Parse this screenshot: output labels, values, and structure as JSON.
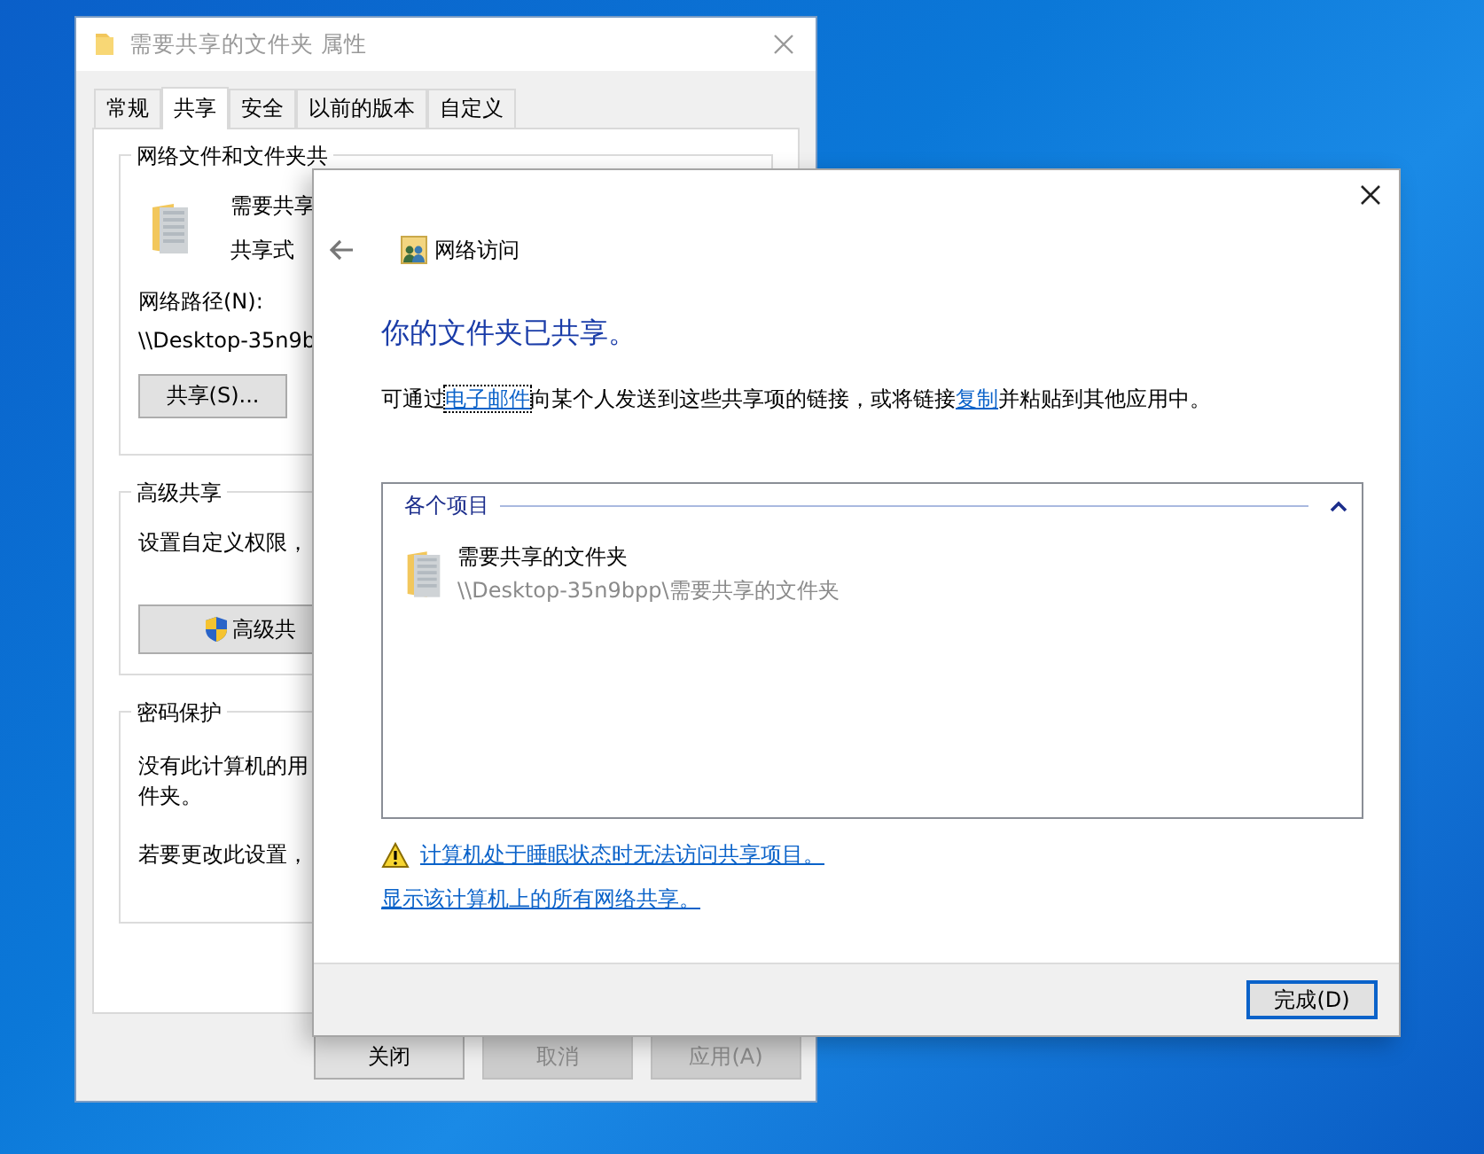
{
  "properties_window": {
    "title": "需要共享的文件夹 属性",
    "tabs": [
      {
        "label": "常规",
        "selected": false
      },
      {
        "label": "共享",
        "selected": true
      },
      {
        "label": "安全",
        "selected": false
      },
      {
        "label": "以前的版本",
        "selected": false
      },
      {
        "label": "自定义",
        "selected": false
      }
    ],
    "network_sharing": {
      "heading": "网络文件和文件夹共",
      "name": "需要共享",
      "status": "共享式",
      "path_label": "网络路径(N):",
      "path": "\\\\Desktop-35n9b",
      "share_button": "共享(S)..."
    },
    "advanced_sharing": {
      "heading": "高级共享",
      "description": "设置自定义权限，",
      "button": "高级共"
    },
    "password_protection": {
      "heading": "密码保护",
      "description_lines": [
        "没有此计算机的用",
        "件夹。"
      ],
      "note": "若要更改此设置，"
    },
    "buttons": [
      {
        "label": "关闭",
        "disabled": false
      },
      {
        "label": "取消",
        "disabled": true
      },
      {
        "label": "应用(A)",
        "disabled": true
      }
    ]
  },
  "network_access_dialog": {
    "nav_title": "网络访问",
    "heading": "你的文件夹已共享。",
    "message": [
      {
        "kind": "text",
        "text": "可通过"
      },
      {
        "kind": "link",
        "text": "电子邮件",
        "focused": true
      },
      {
        "kind": "text",
        "text": "向某个人发送到这些共享项的链接，或将链接"
      },
      {
        "kind": "link",
        "text": "复制",
        "focused": false
      },
      {
        "kind": "text",
        "text": "并粘贴到其他应用中。"
      }
    ],
    "group": {
      "title": "各个项目",
      "expanded": true,
      "items": [
        {
          "name": "需要共享的文件夹",
          "path": "\\\\Desktop-35n9bpp\\需要共享的文件夹"
        }
      ]
    },
    "warning_link": "计算机处于睡眠状态时无法访问共享项目。",
    "show_all_link": "显示该计算机上的所有网络共享。",
    "done_button": {
      "label": "完成(D)",
      "default": true
    }
  }
}
